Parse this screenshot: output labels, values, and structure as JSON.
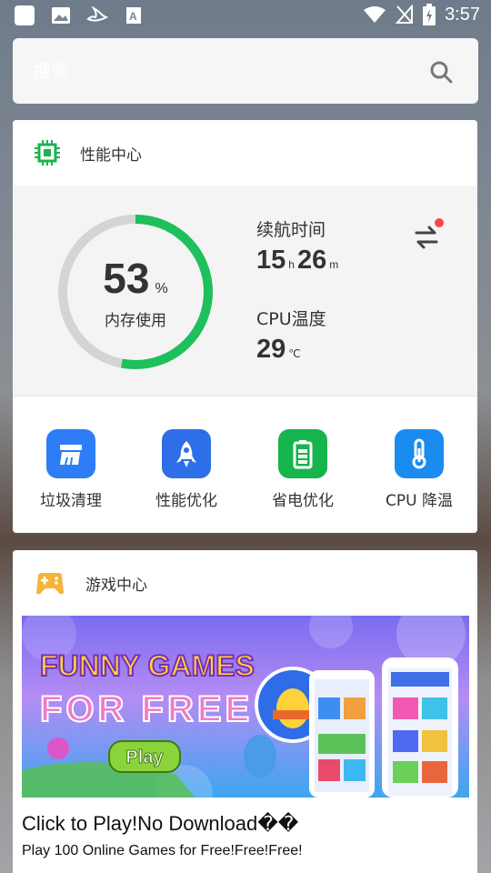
{
  "status_bar": {
    "time": "3:57",
    "left_icons": [
      "app-icon",
      "image-icon",
      "bird-icon",
      "text-icon"
    ],
    "right_icons": [
      "wifi-icon",
      "signal-icon",
      "battery-icon"
    ]
  },
  "search": {
    "placeholder": "搜索"
  },
  "performance": {
    "title": "性能中心",
    "memory_value": "53",
    "memory_unit": "%",
    "memory_label": "内存使用",
    "memory_percent": 53,
    "battery_label": "续航时间",
    "battery_hours": "15",
    "battery_hours_unit": "h",
    "battery_minutes": "26",
    "battery_minutes_unit": "m",
    "cpu_label": "CPU温度",
    "cpu_temp": "29",
    "cpu_temp_unit": "℃",
    "tools": [
      {
        "label": "垃圾清理",
        "icon": "broom-icon",
        "color": "#2e7cf6"
      },
      {
        "label": "性能优化",
        "icon": "rocket-icon",
        "color": "#2e6ee8"
      },
      {
        "label": "省电优化",
        "icon": "battery-icon",
        "color": "#16b44c"
      },
      {
        "label": "CPU 降温",
        "icon": "thermometer-icon",
        "color": "#1a8cf0"
      }
    ],
    "ring_color": "#1dc05a",
    "ring_track_color": "#d4d4d4"
  },
  "games": {
    "title": "游戏中心",
    "banner": {
      "line1": "FUNNY GAMES",
      "line2": "FOR FREE",
      "play": "Play"
    },
    "ad_title": "Click to Play!No Download��",
    "ad_subtitle": "Play 100 Online Games for Free!Free!Free!"
  }
}
